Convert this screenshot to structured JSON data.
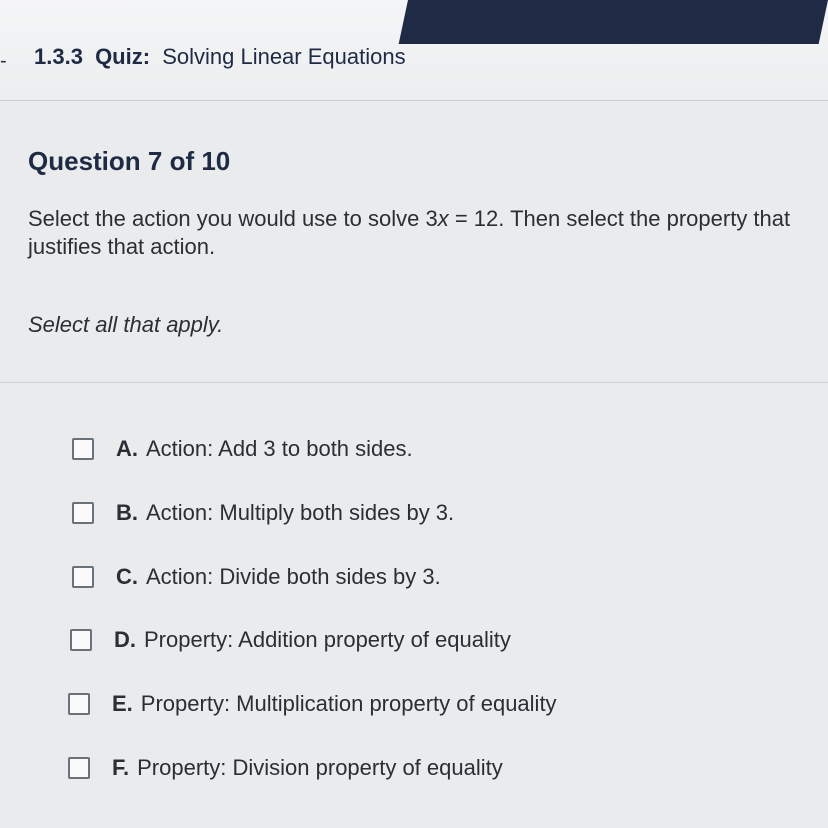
{
  "header": {
    "dash": "-",
    "quiz_number": "1.3.3",
    "quiz_label": "Quiz:",
    "quiz_topic": "Solving Linear Equations"
  },
  "question": {
    "counter": "Question 7 of 10",
    "prompt_before": "Select the action you would use to solve 3",
    "prompt_var": "x",
    "prompt_after": " = 12. Then select the property that justifies that action.",
    "instruction": "Select all that apply."
  },
  "options": [
    {
      "letter": "A.",
      "text": "Action: Add 3 to both sides.",
      "checked": false
    },
    {
      "letter": "B.",
      "text": "Action: Multiply both sides by 3.",
      "checked": false
    },
    {
      "letter": "C.",
      "text": "Action: Divide both sides by 3.",
      "checked": false
    },
    {
      "letter": "D.",
      "text": "Property: Addition property of equality",
      "checked": false
    },
    {
      "letter": "E.",
      "text": "Property: Multiplication property of equality",
      "checked": false
    },
    {
      "letter": "F.",
      "text": "Property: Division property of equality",
      "checked": false
    }
  ],
  "colors": {
    "navy": "#1f2b44",
    "background": "#e9ebec"
  }
}
